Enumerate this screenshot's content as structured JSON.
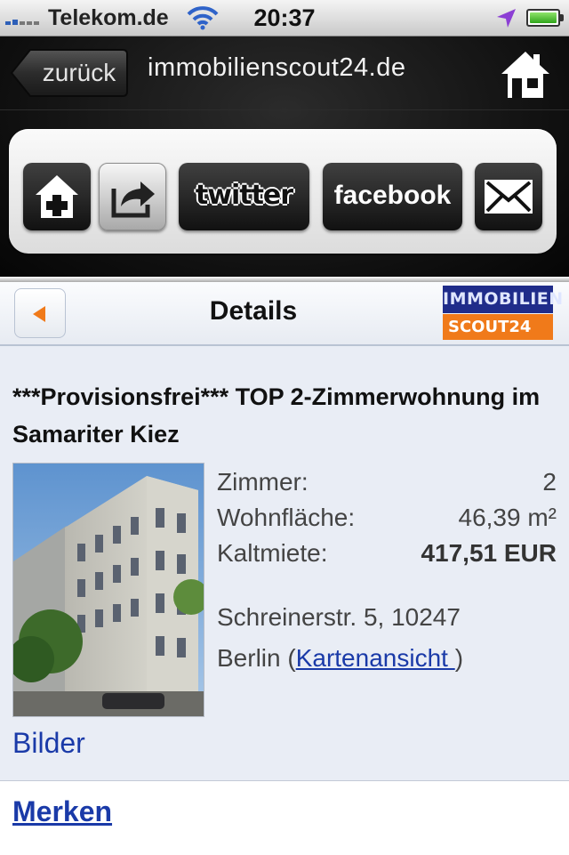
{
  "status_bar": {
    "carrier": "Telekom.de",
    "time": "20:37",
    "wifi_icon": "wifi-icon",
    "location_icon": "location-arrow-icon",
    "battery_icon": "battery-icon"
  },
  "browser": {
    "back_label": "zurück",
    "title": "immobilienscout24.de",
    "home_icon": "home-icon"
  },
  "share_bar": {
    "buttons": [
      {
        "icon": "add-bookmark-icon"
      },
      {
        "icon": "share-arrow-icon"
      },
      {
        "label": "twitter"
      },
      {
        "label": "facebook"
      },
      {
        "icon": "mail-icon"
      }
    ]
  },
  "page_header": {
    "title": "Details",
    "logo_top": "IMMOBILIEN",
    "logo_bottom": "SCOUT24",
    "back_icon": "triangle-left-icon",
    "colors": {
      "logo_blue": "#1f2c8a",
      "logo_orange": "#f07a1a"
    }
  },
  "listing": {
    "title": "***Provisionsfrei*** TOP 2-Zimmerwohnung im Samariter Kiez",
    "facts": [
      {
        "label": "Zimmer:",
        "value": "2"
      },
      {
        "label": "Wohnfläche:",
        "value": "46,39 m²"
      },
      {
        "label": "Kaltmiete:",
        "value": "417,51 EUR"
      }
    ],
    "address_line1": "Schreinerstr. 5, 10247",
    "city": "Berlin (",
    "map_link": "Kartenansicht ",
    "city_close": ")",
    "images_link": "Bilder",
    "save_link": "Merken"
  }
}
